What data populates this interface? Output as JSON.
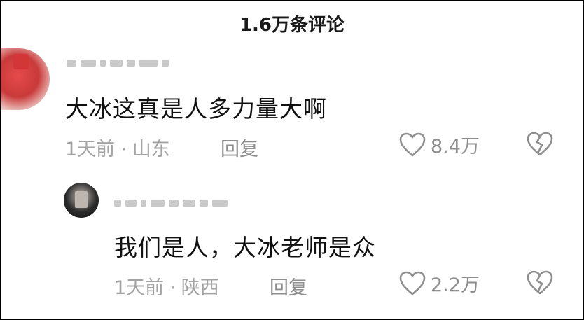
{
  "header": {
    "title": "1.6万条评论"
  },
  "comments": [
    {
      "text": "大冰这真是人多力量大啊",
      "time": "1天前",
      "location": "山东",
      "reply_label": "回复",
      "likes": "8.4万"
    },
    {
      "text": "我们是人，大冰老师是众",
      "time": "1天前",
      "location": "陕西",
      "reply_label": "回复",
      "likes": "2.2万"
    }
  ],
  "separator": "·",
  "icons": {
    "like": "heart-outline-icon",
    "dislike": "broken-heart-icon"
  },
  "colors": {
    "text": "#111111",
    "meta": "#a3a3a3",
    "icon": "#8e8e8e"
  }
}
